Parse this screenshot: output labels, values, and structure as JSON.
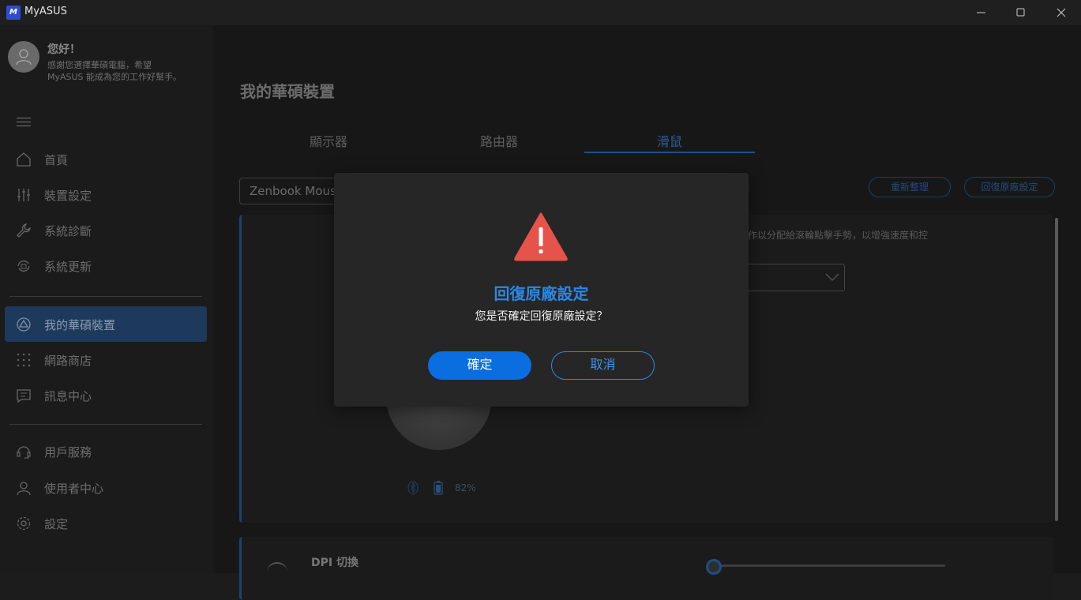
{
  "titlebar": {
    "app_name": "MyASUS",
    "logo_text": "M"
  },
  "sidebar": {
    "greeting_title": "您好！",
    "greeting_text": "感謝您選擇華碩電腦，希望 MyASUS 能成為您的工作好幫手。",
    "items": [
      {
        "label": "首頁",
        "icon": "home-icon"
      },
      {
        "label": "裝置設定",
        "icon": "sliders-icon"
      },
      {
        "label": "系統診斷",
        "icon": "wrench-icon"
      },
      {
        "label": "系統更新",
        "icon": "update-icon"
      },
      {
        "label": "我的華碩裝置",
        "icon": "link-devices-icon"
      },
      {
        "label": "網路商店",
        "icon": "grid-icon"
      },
      {
        "label": "訊息中心",
        "icon": "message-icon"
      },
      {
        "label": "用戶服務",
        "icon": "headset-icon"
      },
      {
        "label": "使用者中心",
        "icon": "user-icon"
      },
      {
        "label": "設定",
        "icon": "gear-icon"
      }
    ]
  },
  "main": {
    "page_title": "我的華碩裝置",
    "tabs": [
      {
        "label": "顯示器"
      },
      {
        "label": "路由器"
      },
      {
        "label": "滑鼠"
      }
    ],
    "active_tab": "滑鼠",
    "device_select_value": "Zenbook Mouse",
    "refresh_button": "重新整理",
    "restore_button": "回復原廠設定",
    "card_description": "操作以分配給滾輪點擊手勢，以增強速度和控",
    "battery_percent": "82%",
    "dpi_label": "DPI 切換"
  },
  "dialog": {
    "title": "回復原廠設定",
    "message": "您是否確定回復原廠設定？",
    "confirm_label": "確定",
    "cancel_label": "取消",
    "accent_color": "#2a88e8",
    "warning_color": "#e5534b"
  }
}
